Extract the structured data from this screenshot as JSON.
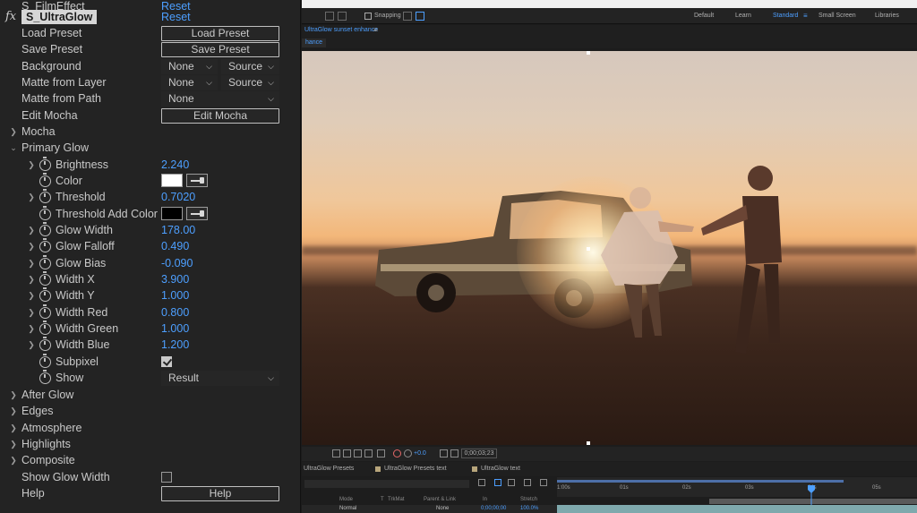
{
  "effect_controls": {
    "prev_effect_name": "S_FilmEffect",
    "prev_reset_label": "Reset",
    "effect_badge": "fx",
    "effect_name": "S_UltraGlow",
    "reset_label": "Reset",
    "load_preset": {
      "label": "Load Preset",
      "button": "Load Preset"
    },
    "save_preset": {
      "label": "Save Preset",
      "button": "Save Preset"
    },
    "background": {
      "label": "Background",
      "option1": "None",
      "option2": "Source"
    },
    "matte_from_layer": {
      "label": "Matte from Layer",
      "option1": "None",
      "option2": "Source"
    },
    "matte_from_path": {
      "label": "Matte from Path",
      "option1": "None"
    },
    "edit_mocha": {
      "label": "Edit Mocha",
      "button": "Edit Mocha"
    },
    "mocha": {
      "label": "Mocha"
    },
    "primary_glow": {
      "label": "Primary Glow",
      "brightness": {
        "label": "Brightness",
        "value": "2.240"
      },
      "color": {
        "label": "Color",
        "swatch": "#ffffff"
      },
      "threshold": {
        "label": "Threshold",
        "value": "0.7020"
      },
      "threshold_add_color": {
        "label": "Threshold Add Color",
        "swatch": "#000000"
      },
      "glow_width": {
        "label": "Glow Width",
        "value": "178.00"
      },
      "glow_falloff": {
        "label": "Glow Falloff",
        "value": "0.490"
      },
      "glow_bias": {
        "label": "Glow Bias",
        "value": "-0.090"
      },
      "width_x": {
        "label": "Width X",
        "value": "3.900"
      },
      "width_y": {
        "label": "Width Y",
        "value": "1.000"
      },
      "width_red": {
        "label": "Width Red",
        "value": "0.800"
      },
      "width_green": {
        "label": "Width Green",
        "value": "1.000"
      },
      "width_blue": {
        "label": "Width Blue",
        "value": "1.200"
      },
      "subpixel": {
        "label": "Subpixel",
        "checked": true
      },
      "show": {
        "label": "Show",
        "value": "Result"
      }
    },
    "after_glow": {
      "label": "After Glow"
    },
    "edges": {
      "label": "Edges"
    },
    "atmosphere": {
      "label": "Atmosphere"
    },
    "highlights": {
      "label": "Highlights"
    },
    "composite": {
      "label": "Composite"
    },
    "show_glow_width": {
      "label": "Show Glow Width",
      "checked": false
    },
    "help": {
      "label": "Help",
      "button": "Help"
    }
  },
  "toolbar": {
    "snapping_label": "Snapping",
    "workspaces": [
      "Default",
      "Learn",
      "Standard",
      "Small Screen",
      "Libraries"
    ],
    "active_workspace": "Standard"
  },
  "composition": {
    "tab_label": "UltraGlow sunset enhance",
    "sub_tab_label": "hance"
  },
  "viewer_bar": {
    "exposure": "+0.0",
    "timecode": "0;00;03;23"
  },
  "timeline": {
    "tabs": [
      "UltraGlow Presets",
      "UltraGlow Presets text",
      "UltraGlow text"
    ],
    "ruler_labels": [
      "1:00s",
      "01s",
      "02s",
      "03s",
      "04s",
      "05s"
    ],
    "columns": [
      "Mode",
      "T",
      "TrkMat",
      "Parent & Link",
      "In",
      "Stretch"
    ],
    "layer": {
      "mode": "Normal",
      "parent": "None",
      "in": "0;00;00;00",
      "stretch": "100.0%"
    }
  },
  "colors": {
    "accent": "#4d9fff",
    "panel_bg": "#232323"
  }
}
